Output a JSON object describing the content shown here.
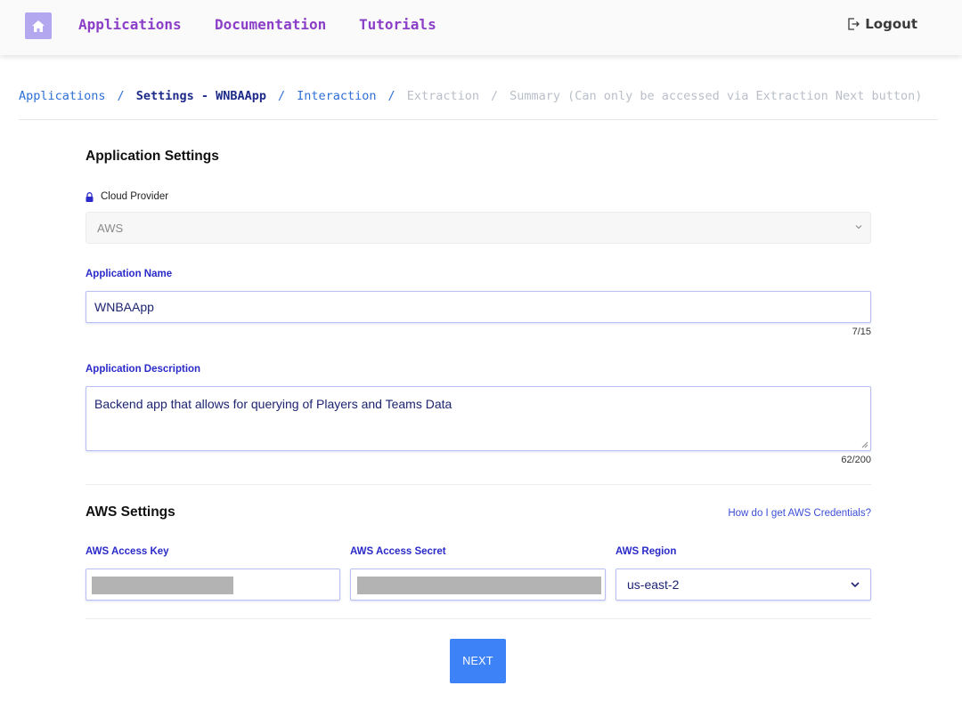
{
  "nav": {
    "home_icon": "home-icon",
    "links": [
      "Applications",
      "Documentation",
      "Tutorials"
    ],
    "logout_label": "Logout",
    "logout_icon": "logout-icon"
  },
  "breadcrumb": {
    "items": [
      {
        "label": "Applications",
        "state": "link"
      },
      {
        "label": "Settings - WNBAApp",
        "state": "current"
      },
      {
        "label": "Interaction",
        "state": "link"
      },
      {
        "label": "Extraction",
        "state": "disabled"
      },
      {
        "label": "Summary (Can only be accessed via Extraction Next button)",
        "state": "disabled"
      }
    ],
    "separator": "/"
  },
  "app_settings": {
    "title": "Application Settings",
    "cloud_provider_label": "Cloud Provider",
    "cloud_provider_value": "AWS",
    "name_label": "Application Name",
    "name_value": "WNBAApp",
    "name_counter": "7/15",
    "description_label": "Application Description",
    "description_value": "Backend app that allows for querying of Players and Teams Data",
    "description_counter": "62/200"
  },
  "aws_settings": {
    "title": "AWS Settings",
    "help_link": "How do I get AWS Credentials?",
    "access_key_label": "AWS Access Key",
    "access_secret_label": "AWS Access Secret",
    "region_label": "AWS Region",
    "region_value": "us-east-2"
  },
  "actions": {
    "next_label": "NEXT"
  },
  "colors": {
    "nav_link": "#8b3fc9",
    "breadcrumb_link": "#2f6fd6",
    "label": "#2a2ac8",
    "next_button": "#3d82f6",
    "home_button": "#b3a8ef"
  }
}
